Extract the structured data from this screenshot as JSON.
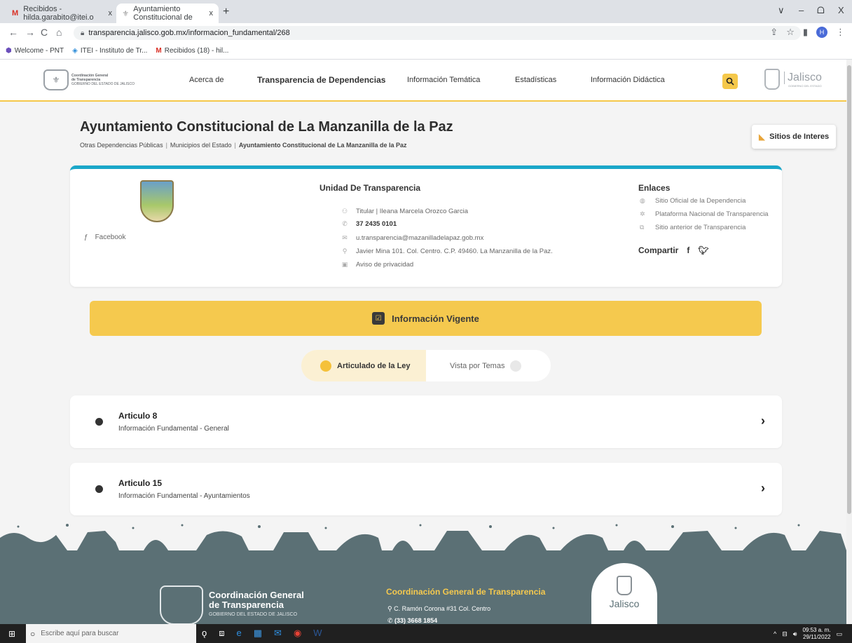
{
  "browser": {
    "tabs": [
      {
        "favicon": "M",
        "title": "Recibidos - hilda.garabito@itei.o",
        "close": "x"
      },
      {
        "favicon": "⚜",
        "title": "Ayuntamiento Constitucional de",
        "close": "x"
      }
    ],
    "new_tab": "+",
    "window_controls": [
      "∨",
      "–",
      "ᗝ",
      "X"
    ],
    "url": "transparencia.jalisco.gob.mx/informacion_fundamental/268",
    "profile_initial": "H",
    "bookmarks": [
      {
        "icon": "⬢",
        "label": "Welcome - PNT"
      },
      {
        "icon": "◈",
        "label": "ITEI - Instituto de Tr..."
      },
      {
        "icon": "M",
        "label": "Recibidos (18) - hil..."
      }
    ]
  },
  "header": {
    "logo_line1": "Coordinación General",
    "logo_line2": "de Transparencia",
    "logo_line3": "GOBIERNO DEL ESTADO DE JALISCO",
    "menu": [
      "Acerca de",
      "Transparencia de Dependencias",
      "Información Temática",
      "Estadísticas",
      "Información Didáctica"
    ],
    "jalisco_logo": "Jalisco",
    "jalisco_sub": "GOBIERNO DEL ESTADO"
  },
  "page": {
    "title": "Ayuntamiento Constitucional de La Manzanilla de la Paz",
    "breadcrumb": [
      "Otras Dependencias Públicas",
      "Municipios del Estado",
      "Ayuntamiento Constitucional de La Manzanilla de la Paz"
    ],
    "breadcrumb_sep": "|",
    "sitios_button": "Sitios de Interes"
  },
  "info_card": {
    "facebook": "Facebook",
    "unidad_title": "Unidad De Transparencia",
    "titular": "Titular | Ileana Marcela Orozco Garcia",
    "phone": "37 2435 0101",
    "email": "u.transparencia@mazanilladelapaz.gob.mx",
    "address": "Javier Mina 101. Col. Centro. C.P. 49460. La Manzanilla de la Paz.",
    "privacy": "Aviso de privacidad",
    "enlaces_title": "Enlaces",
    "enlaces": [
      "Sitio Oficial de la Dependencia",
      "Plataforma Nacional de Transparencia",
      "Sitio anterior de Transparencia"
    ],
    "compartir": "Compartir"
  },
  "vigente": "Información Vigente",
  "toggle": {
    "option_a": "Articulado de la Ley",
    "option_b": "Vista por Temas"
  },
  "articles": [
    {
      "title": "Articulo 8",
      "subtitle": "Información Fundamental - General"
    },
    {
      "title": "Articulo 15",
      "subtitle": "Información Fundamental - Ayuntamientos"
    }
  ],
  "footer": {
    "logo_line1": "Coordinación General",
    "logo_line2": "de Transparencia",
    "logo_line3": "GOBIERNO DEL ESTADO DE JALISCO",
    "org": "Coordinación General de Transparencia",
    "address": "C. Ramón Corona #31 Col. Centro",
    "phone": "(33) 3668 1854",
    "jalisco": "Jalisco"
  },
  "taskbar": {
    "search_placeholder": "Escribe aquí para buscar",
    "time": "09:53 a. m.",
    "date": "29/11/2022"
  },
  "colors": {
    "accent_yellow": "#f5c94e",
    "card_top": "#1aa7c9",
    "footer_bg": "#5b7075"
  }
}
